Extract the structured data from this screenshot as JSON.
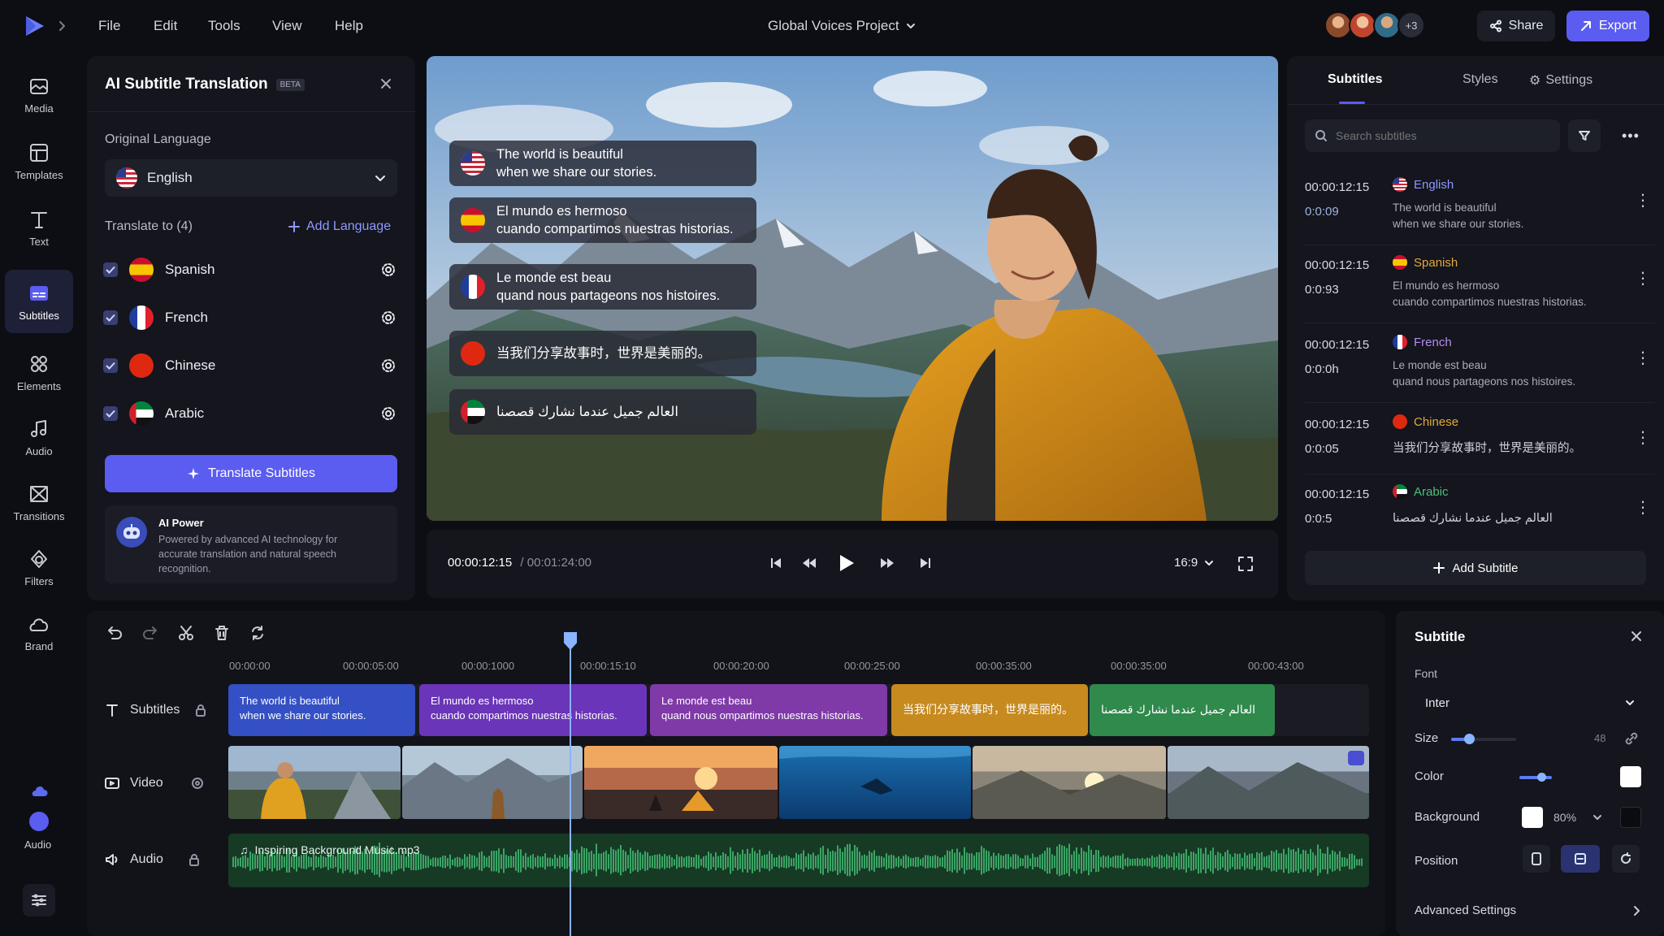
{
  "menu": {
    "items": [
      "File",
      "Edit",
      "Tools",
      "View",
      "Help"
    ],
    "project_title": "Global Voices Project"
  },
  "header": {
    "collaborators_extra": "+3",
    "share_label": "Share",
    "export_label": "Export"
  },
  "sidebar": {
    "items": [
      {
        "label": "Media",
        "icon": "media-icon"
      },
      {
        "label": "Templates",
        "icon": "templates-icon"
      },
      {
        "label": "Text",
        "icon": "text-icon"
      },
      {
        "label": "Subtitles",
        "icon": "subtitles-icon",
        "active": true
      },
      {
        "label": "Elements",
        "icon": "elements-icon"
      },
      {
        "label": "Audio",
        "icon": "audio-icon"
      },
      {
        "label": "Transitions",
        "icon": "transitions-icon"
      },
      {
        "label": "Filters",
        "icon": "filters-icon"
      },
      {
        "label": "Brand",
        "icon": "brand-icon"
      }
    ],
    "bottom_label": "Audio"
  },
  "translate_panel": {
    "title": "AI Subtitle Translation",
    "badge": "BETA",
    "original_language_label": "Original Language",
    "original_language_value": "English",
    "translate_to_label": "Translate to (4)",
    "add_language_label": "Add Language",
    "languages": [
      "Spanish",
      "French",
      "Chinese",
      "Arabic"
    ],
    "translate_button": "Translate Subtitles",
    "ai_title": "AI Power",
    "ai_description": "Powered by advanced AI technology for accurate translation and natural speech recognition."
  },
  "preview": {
    "overlays": [
      {
        "flag": "us",
        "line1": "The world is beautiful",
        "line2": "when we share our stories."
      },
      {
        "flag": "es",
        "line1": "El mundo es hermoso",
        "line2": "cuando compartimos nuestras historias."
      },
      {
        "flag": "fr",
        "line1": "Le monde est beau",
        "line2": "quand nous partageons nos histoires."
      },
      {
        "flag": "cn",
        "line1": "当我们分享故事时，世界是美丽的。",
        "line2": ""
      },
      {
        "flag": "ae",
        "line1": "العالم جميل عندما نشارك قصصنا",
        "line2": ""
      }
    ],
    "current_time": "00:00:12:15",
    "total_time": "/ 00:01:24:00",
    "aspect": "16:9"
  },
  "subtitles_panel": {
    "tabs": [
      "Subtitles",
      "Styles",
      "Settings"
    ],
    "search_placeholder": "Search subtitles",
    "entries": [
      {
        "time": "00:00:12:15",
        "dur": "0:0:09",
        "lang": "English",
        "flag": "us",
        "text1": "The world is beautiful",
        "text2": "when we share our stories."
      },
      {
        "time": "00:00:12:15",
        "dur": "0:0:93",
        "lang": "Spanish",
        "flag": "es",
        "text1": "El mundo es hermoso",
        "text2": "cuando compartimos nuestras historias."
      },
      {
        "time": "00:00:12:15",
        "dur": "0:0:0h",
        "lang": "French",
        "flag": "fr",
        "text1": "Le monde est beau",
        "text2": "quand nous partageons nos histoires."
      },
      {
        "time": "00:00:12:15",
        "dur": "0:0:05",
        "lang": "Chinese",
        "flag": "cn",
        "text1": "当我们分享故事时，世界是美丽的。",
        "text2": ""
      },
      {
        "time": "00:00:12:15",
        "dur": "0:0:5",
        "lang": "Arabic",
        "flag": "ae",
        "text1": "العالم جميل عندما نشارك قصصنا",
        "text2": ""
      }
    ],
    "add_subtitle": "Add Subtitle"
  },
  "timeline": {
    "ruler": [
      "00:00:00",
      "00:00:05:00",
      "00:00:1000",
      "00:00:15:10",
      "00:00:20:00",
      "00:00:25:00",
      "00:00:35:00",
      "00:00:35:00",
      "00:00:43:00"
    ],
    "tracks": [
      "Subtitles",
      "Video",
      "Audio"
    ],
    "subtitle_clips": [
      {
        "l1": "The world is beautiful",
        "l2": "when we share our stories."
      },
      {
        "l1": "El mundo es hermoso",
        "l2": "cuando compartimos nuestras historias."
      },
      {
        "l1": "Le monde est beau",
        "l2": "quand nous ompartimos nuestras historias."
      },
      {
        "l1": "当我们分享故事时，世界是丽的。",
        "l2": ""
      },
      {
        "l1": "العالم جميل عندما نشارك قصصنا",
        "l2": ""
      }
    ],
    "audio_file": "Inspiring Background Music.mp3"
  },
  "subtitle_settings": {
    "title": "Subtitle",
    "font_label": "Font",
    "font_value": "Inter",
    "size_label": "Size",
    "size_value": "48",
    "color_label": "Color",
    "background_label": "Background",
    "background_opacity": "80%",
    "position_label": "Position",
    "advanced_label": "Advanced Settings"
  },
  "colors": {
    "accent": "#5b5cf0",
    "subtitle_clip_blue": "#3450c4",
    "subtitle_clip_purple": "#6a35b8",
    "subtitle_clip_violet": "#7f3aa8",
    "subtitle_clip_orange": "#c78a1e",
    "subtitle_clip_green": "#2f8a4c",
    "audio_wave": "#3ba565"
  }
}
